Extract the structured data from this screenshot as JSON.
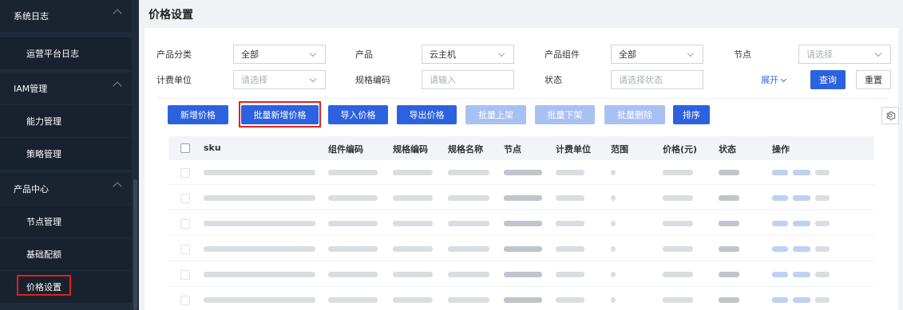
{
  "sidebar": {
    "items": [
      {
        "label": "系统日志",
        "type": "group",
        "expanded": true
      },
      {
        "label": "运营平台日志",
        "type": "sub"
      },
      {
        "label": "IAM管理",
        "type": "group",
        "expanded": true
      },
      {
        "label": "能力管理",
        "type": "sub"
      },
      {
        "label": "策略管理",
        "type": "sub"
      },
      {
        "label": "产品中心",
        "type": "group",
        "expanded": true
      },
      {
        "label": "节点管理",
        "type": "sub"
      },
      {
        "label": "基础配额",
        "type": "sub"
      },
      {
        "label": "价格设置",
        "type": "sub",
        "active": true
      }
    ]
  },
  "page": {
    "title": "价格设置"
  },
  "filters": {
    "product_category": {
      "label": "产品分类",
      "value": "全部"
    },
    "product": {
      "label": "产品",
      "value": "云主机"
    },
    "component": {
      "label": "产品组件",
      "value": "全部"
    },
    "node": {
      "label": "节点",
      "placeholder": "请选择"
    },
    "billing_unit": {
      "label": "计费单位",
      "placeholder": "请选择"
    },
    "spec_code": {
      "label": "规格编码",
      "placeholder": "请输入"
    },
    "status": {
      "label": "状态",
      "placeholder": "请选择状态"
    },
    "expand_label": "展开",
    "search_label": "查询",
    "reset_label": "重置"
  },
  "toolbar": {
    "add_price": "新增价格",
    "batch_add_price": "批量新增价格",
    "import_price": "导入价格",
    "export_price": "导出价格",
    "batch_list": "批量上架",
    "batch_unlist": "批量下架",
    "batch_delete": "批量删除",
    "sort": "排序"
  },
  "table": {
    "columns": [
      "sku",
      "组件编码",
      "规格编码",
      "规格名称",
      "节点",
      "计费单位",
      "范围",
      "价格(元)",
      "状态",
      "操作"
    ],
    "row_count": 6
  },
  "colors": {
    "primary": "#2c62e0",
    "sidebar_bg": "#1f2b3a",
    "highlight": "#e02020"
  }
}
